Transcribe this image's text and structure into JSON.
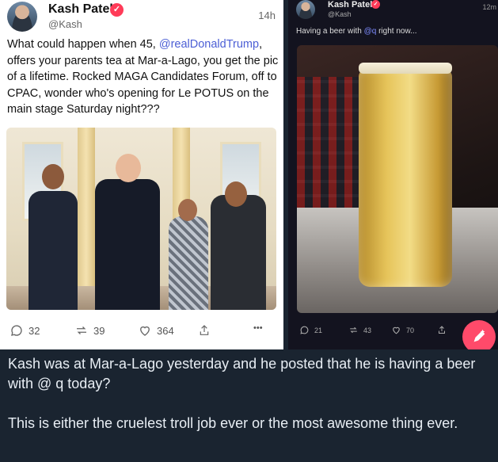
{
  "left_post": {
    "author": "Kash Patel",
    "handle": "@Kash",
    "time": "14h",
    "text_before_mention": "What could happen when 45, ",
    "mention": "@realDonaldTrump",
    "text_after_mention": ", offers your parents tea at Mar-a-Lago, you get the pic of a lifetime. Rocked MAGA Candidates Forum, off to CPAC, wonder who's opening for Le POTUS on the main stage Saturday night???",
    "actions": {
      "replies": "32",
      "reposts": "39",
      "likes": "364"
    },
    "verified_glyph": "✓",
    "more_glyph": "•••"
  },
  "right_post": {
    "author": "Kash Patel",
    "handle": "@Kash",
    "time": "12m",
    "text_before_mention": "Having a beer with ",
    "mention": "@q",
    "text_after_mention": " right now...",
    "actions": {
      "replies": "21",
      "reposts": "43",
      "likes": "70"
    },
    "verified_glyph": "✓"
  },
  "caption": {
    "paragraph1": "Kash was at Mar-a-Lago yesterday and he posted that he is having a beer with @ q today?",
    "paragraph2": "This is either the cruelest troll job ever or the most awesome thing ever."
  },
  "colors": {
    "accent": "#ff3b58",
    "mention_light": "#4c5fd5",
    "mention_dark": "#7d8cff",
    "caption_bg": "#1a2430"
  }
}
